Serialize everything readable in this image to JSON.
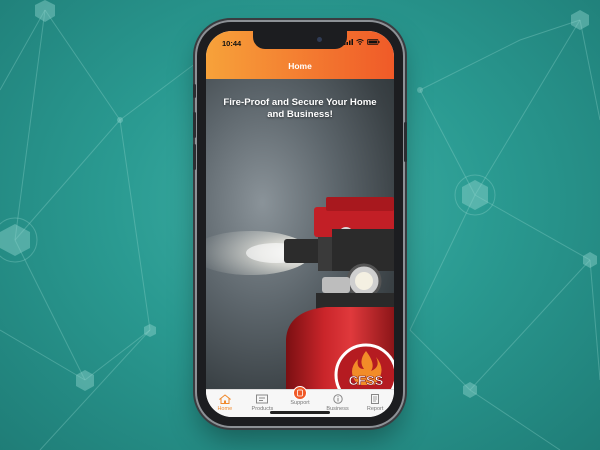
{
  "status": {
    "time": "10:44"
  },
  "nav": {
    "title": "Home"
  },
  "hero": {
    "title": "Fire-Proof and Secure Your Home and Business!",
    "badge": "CFSS"
  },
  "tabs": [
    {
      "label": "Home",
      "icon": "home-icon",
      "active": true
    },
    {
      "label": "Products",
      "icon": "products-icon",
      "active": false
    },
    {
      "label": "Support",
      "icon": "support-icon",
      "active": false
    },
    {
      "label": "Business",
      "icon": "business-icon",
      "active": false
    },
    {
      "label": "Report",
      "icon": "report-icon",
      "active": false
    }
  ],
  "colors": {
    "accent_start": "#f7a23a",
    "accent_end": "#f05a28",
    "background": "#2a9a91"
  }
}
